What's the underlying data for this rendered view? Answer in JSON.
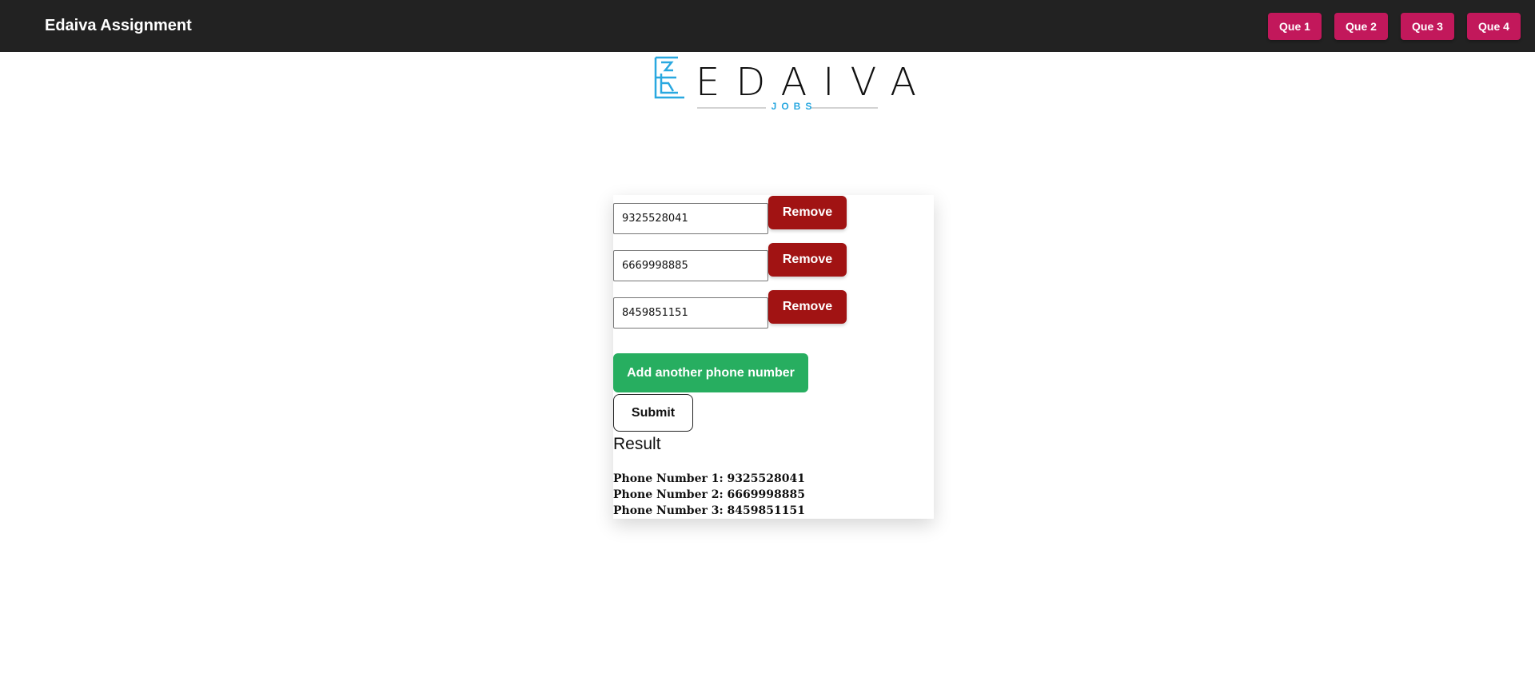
{
  "navbar": {
    "brand": "Edaiva Assignment",
    "buttons": [
      "Que 1",
      "Que 2",
      "Que 3",
      "Que 4"
    ]
  },
  "logo": {
    "word": "EDAIVA",
    "tagline": "JOBS",
    "colors": {
      "mark": "#29a8e0",
      "text": "#111111"
    }
  },
  "form": {
    "phones": [
      {
        "value": "9325528041",
        "remove_label": "Remove"
      },
      {
        "value": "6669998885",
        "remove_label": "Remove"
      },
      {
        "value": "8459851151",
        "remove_label": "Remove"
      }
    ],
    "add_label": "Add another phone number",
    "submit_label": "Submit"
  },
  "result": {
    "title": "Result",
    "lines": [
      "Phone Number 1: 9325528041",
      "Phone Number 2: 6669998885",
      "Phone Number 3: 8459851151"
    ]
  },
  "colors": {
    "navbar_bg": "#222222",
    "nav_button": "#c2185b",
    "remove_button": "#a11313",
    "add_button": "#27ae60"
  }
}
